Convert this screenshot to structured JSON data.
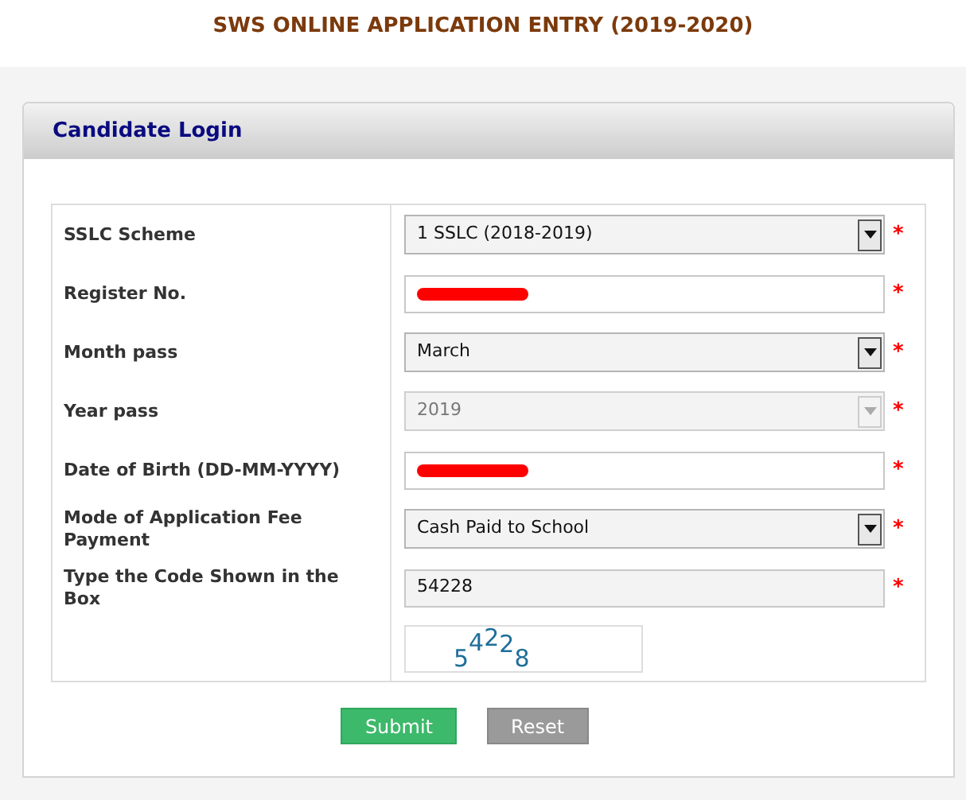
{
  "page_title": "SWS ONLINE APPLICATION ENTRY (2019-2020)",
  "panel_title": "Candidate Login",
  "fields": [
    {
      "label": "SSLC Scheme",
      "kind": "select",
      "value": "1 SSLC (2018-2019)",
      "disabled": false,
      "redacted": false,
      "required": "*"
    },
    {
      "label": "Register No.",
      "kind": "input",
      "disabled": false,
      "redacted": true,
      "required": "*"
    },
    {
      "label": "Month pass",
      "kind": "select",
      "value": "March",
      "disabled": false,
      "redacted": false,
      "required": "*"
    },
    {
      "label": "Year pass",
      "kind": "select",
      "value": "2019",
      "disabled": true,
      "redacted": false,
      "required": "*"
    },
    {
      "label": "Date of Birth (DD-MM-YYYY)",
      "kind": "input",
      "disabled": false,
      "redacted": true,
      "required": "*"
    },
    {
      "label": "Mode of Application Fee Payment",
      "kind": "select",
      "value": "Cash Paid to School",
      "disabled": false,
      "redacted": false,
      "required": "*"
    },
    {
      "label": "Type the Code Shown in the Box",
      "kind": "input",
      "value": "54228",
      "disabled": false,
      "redacted": false,
      "required": "*"
    }
  ],
  "captcha": "54228",
  "buttons": [
    {
      "label": "Submit",
      "kind": "primary"
    },
    {
      "label": "Reset",
      "kind": "secondary"
    }
  ]
}
